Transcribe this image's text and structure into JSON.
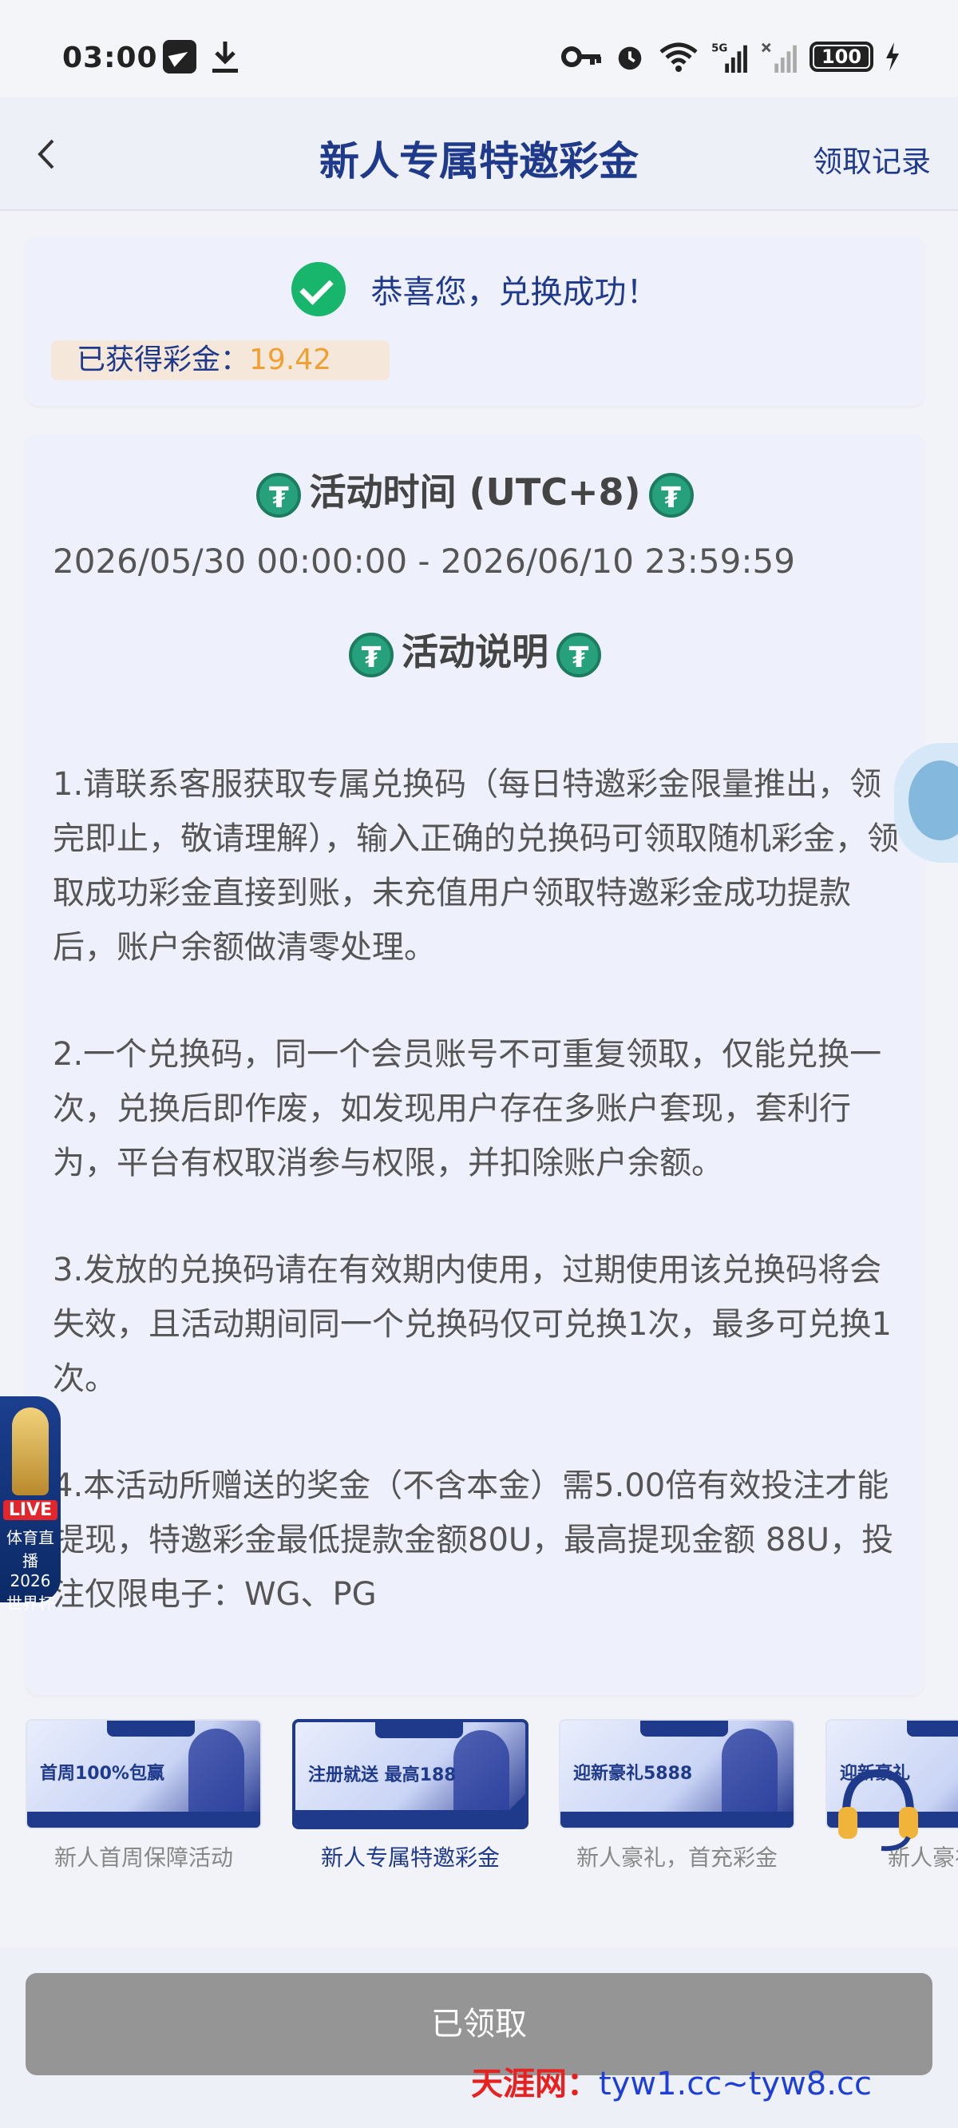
{
  "status_bar": {
    "time": "03:00",
    "network": "5G",
    "battery": "100"
  },
  "header": {
    "title": "新人专属特邀彩金",
    "record_link": "领取记录"
  },
  "result": {
    "message": "恭喜您，兑换成功！",
    "earned_label": "已获得彩金：",
    "earned_value": "19.42"
  },
  "activity": {
    "time_title": "活动时间 (UTC+8)",
    "time_range": "2026/05/30 00:00:00 - 2026/06/10 23:59:59",
    "desc_title": "活动说明",
    "rules": [
      "1.请联系客服获取专属兑换码（每日特邀彩金限量推出，领完即止，敬请理解），输入正确的兑换码可领取随机彩金，领取成功彩金直接到账，未充值用户领取特邀彩金成功提款后，账户余额做清零处理。",
      "2.一个兑换码，同一个会员账号不可重复领取，仅能兑换一次，兑换后即作废，如发现用户存在多账户套现，套利行为，平台有权取消参与权限，并扣除账户余额。",
      "3.发放的兑换码请在有效期内使用，过期使用该兑换码将会失效，且活动期间同一个兑换码仅可兑换1次，最多可兑换1次。",
      "4.本活动所赠送的奖金（不含本金）需5.00倍有效投注才能提现，特邀彩金最低提款金额80U，最高提现金额 88U，投注仅限电子：WG、PG"
    ]
  },
  "float_left": {
    "live": "LIVE",
    "line1": "体育直播",
    "line2": "2026",
    "line3": "世界杯"
  },
  "banners": [
    {
      "caption": "新人首周保障活动",
      "text": "首周100%包赢"
    },
    {
      "caption": "新人专属特邀彩金",
      "text": "注册就送 最高188"
    },
    {
      "caption": "新人豪礼，首充彩金",
      "text": "迎新豪礼5888"
    },
    {
      "caption": "新人豪礼，",
      "text": "迎新豪礼"
    }
  ],
  "button": {
    "label": "已领取"
  },
  "watermark": {
    "cn": "天涯网：",
    "urls": "tyw1.cc~tyw8.cc"
  },
  "colors": {
    "brand": "#1f3a8a",
    "success": "#18b56c",
    "accent": "#f0a030",
    "disabled": "#959595"
  }
}
